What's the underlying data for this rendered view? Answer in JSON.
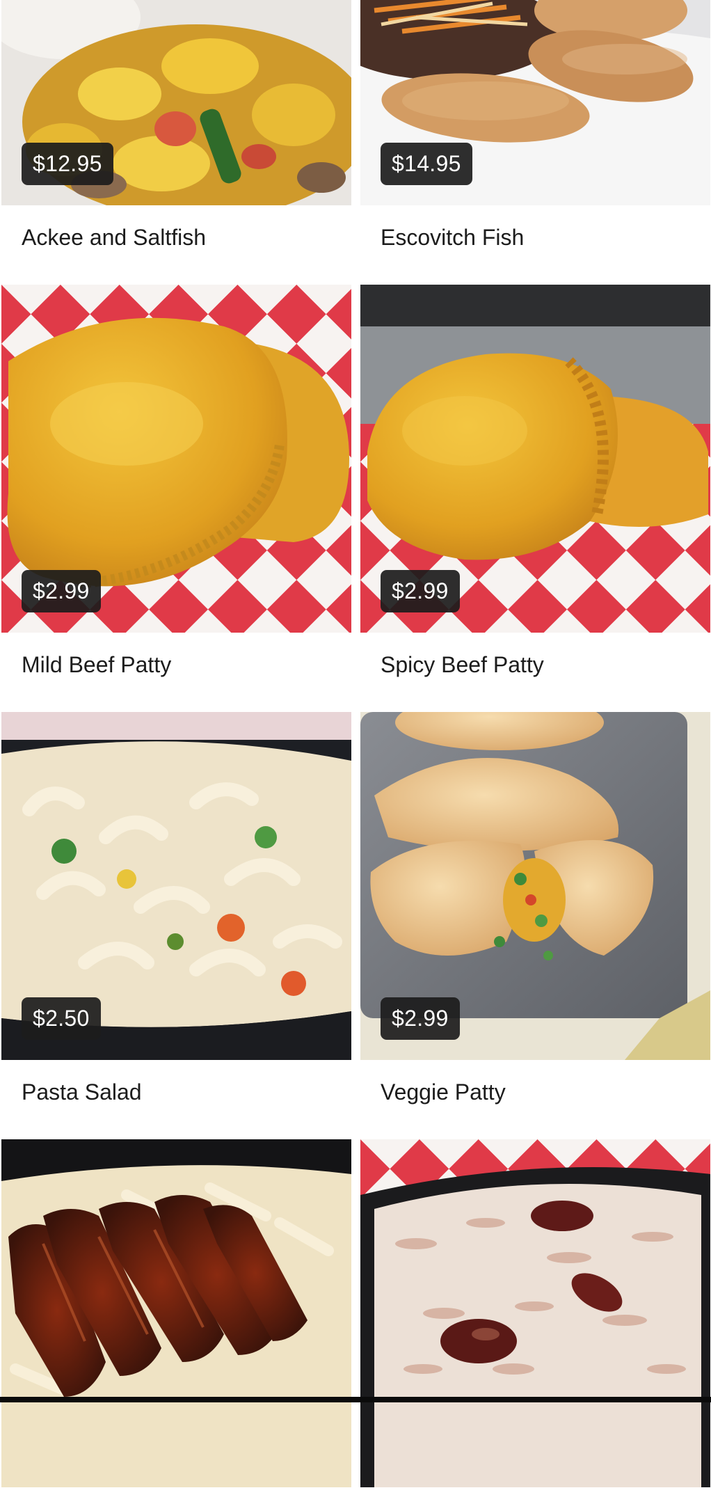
{
  "menu": {
    "items": [
      {
        "name": "Ackee and Saltfish",
        "price": "$12.95",
        "image": "ackee-saltfish-photo"
      },
      {
        "name": "Escovitch Fish",
        "price": "$14.95",
        "image": "escovitch-fish-photo"
      },
      {
        "name": "Mild Beef Patty",
        "price": "$2.99",
        "image": "mild-beef-patty-photo"
      },
      {
        "name": "Spicy Beef Patty",
        "price": "$2.99",
        "image": "spicy-beef-patty-photo"
      },
      {
        "name": "Pasta Salad",
        "price": "$2.50",
        "image": "pasta-salad-photo"
      },
      {
        "name": "Veggie Patty",
        "price": "$2.99",
        "image": "veggie-patty-photo"
      },
      {
        "name": "",
        "price": "",
        "image": "jerk-chicken-photo"
      },
      {
        "name": "",
        "price": "",
        "image": "rice-and-peas-photo"
      }
    ]
  },
  "colors": {
    "price_badge_bg": "#1c1c1c",
    "price_text": "#ffffff",
    "name_text": "#1c1c1c",
    "checker_red": "#e03a48",
    "patty_gold": "#e6a92c"
  }
}
